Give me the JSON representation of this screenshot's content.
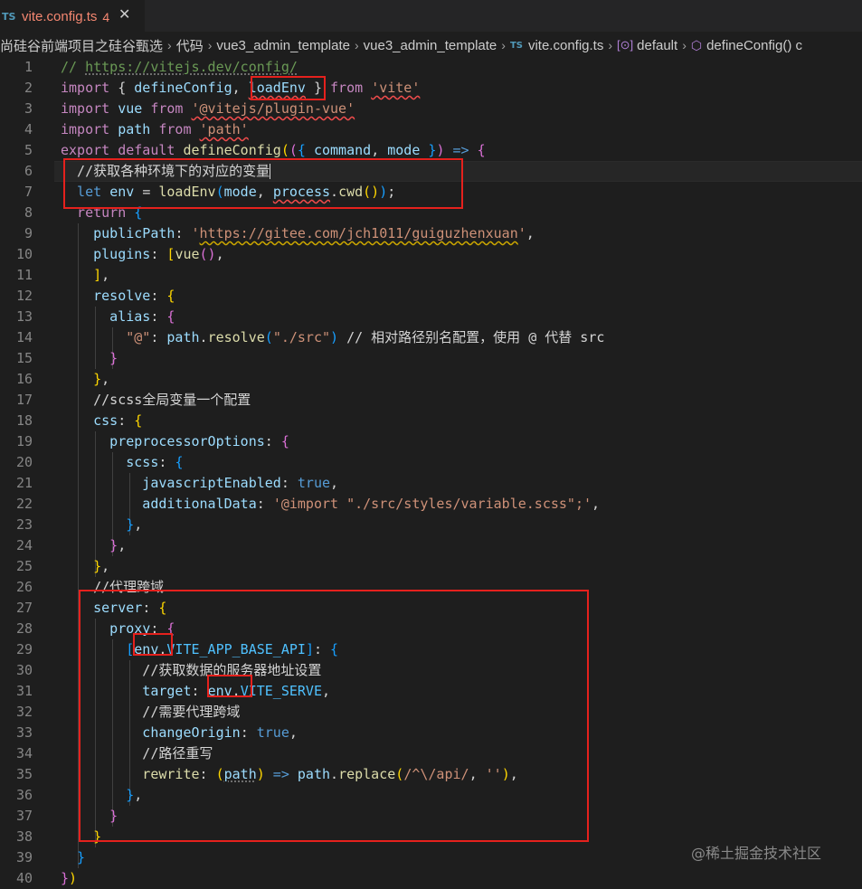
{
  "tab": {
    "icon": "TS",
    "filename": "vite.config.ts",
    "problems": "4",
    "close": "✕"
  },
  "breadcrumb": [
    "尚硅谷前端项目之硅谷甄选",
    "代码",
    "vue3_admin_template",
    "vue3_admin_template",
    "vite.config.ts",
    "default",
    "defineConfig() c"
  ],
  "watermark": "@稀土掘金技术社区",
  "colors": {
    "box": "#e5211d",
    "background": "#1e1e1e"
  },
  "line_numbers": [
    "1",
    "2",
    "3",
    "4",
    "5",
    "6",
    "7",
    "8",
    "9",
    "10",
    "11",
    "12",
    "13",
    "14",
    "15",
    "16",
    "17",
    "18",
    "19",
    "20",
    "21",
    "22",
    "23",
    "24",
    "25",
    "26",
    "27",
    "28",
    "29",
    "30",
    "31",
    "32",
    "33",
    "34",
    "35",
    "36",
    "37",
    "38",
    "39",
    "40"
  ],
  "code": [
    [
      [
        "cm",
        "// "
      ],
      [
        "cm sqd",
        "https://vitejs.dev/config/"
      ]
    ],
    [
      [
        "kw",
        "import "
      ],
      [
        "pn",
        "{ "
      ],
      [
        "vr",
        "defineConfig"
      ],
      [
        "pn",
        ", "
      ],
      [
        "vr sq",
        "loadEnv"
      ],
      [
        "pn",
        " } "
      ],
      [
        "kw",
        "from "
      ],
      [
        "st sq",
        "'vite'"
      ]
    ],
    [
      [
        "kw",
        "import "
      ],
      [
        "vr",
        "vue "
      ],
      [
        "kw",
        "from "
      ],
      [
        "st sq",
        "'@vitejs/plugin-vue'"
      ]
    ],
    [
      [
        "kw",
        "import "
      ],
      [
        "vr",
        "path "
      ],
      [
        "kw",
        "from "
      ],
      [
        "st sq",
        "'path'"
      ]
    ],
    [
      [
        "kw",
        "export default "
      ],
      [
        "fn",
        "defineConfig"
      ],
      [
        "b1",
        "("
      ],
      [
        "b2",
        "("
      ],
      [
        "b3",
        "{ "
      ],
      [
        "vr",
        "command"
      ],
      [
        "pn",
        ", "
      ],
      [
        "vr",
        "mode "
      ],
      [
        "b3",
        "}"
      ],
      [
        "b2",
        ")"
      ],
      [
        "bl",
        " => "
      ],
      [
        "b2",
        "{"
      ]
    ],
    [
      [
        "cmw",
        "  //获取各种环境下的对应的变量"
      ],
      [
        "caret",
        ""
      ]
    ],
    [
      [
        "bl",
        "  let "
      ],
      [
        "vr",
        "env "
      ],
      [
        "pn",
        "= "
      ],
      [
        "fn",
        "loadEnv"
      ],
      [
        "b3",
        "("
      ],
      [
        "vr",
        "mode"
      ],
      [
        "pn",
        ", "
      ],
      [
        "vr sq",
        "process"
      ],
      [
        "pn",
        "."
      ],
      [
        "fn",
        "cwd"
      ],
      [
        "b1",
        "()"
      ],
      [
        "b3",
        ")"
      ],
      [
        "pn",
        ";"
      ]
    ],
    [
      [
        "kw",
        "  return "
      ],
      [
        "b3",
        "{"
      ]
    ],
    [
      [
        "vr",
        "    publicPath"
      ],
      [
        "pn",
        ": "
      ],
      [
        "st",
        "'"
      ],
      [
        "st sqy",
        "https://gitee.com/jch1011/guiguzhenxuan"
      ],
      [
        "st",
        "'"
      ],
      [
        "pn",
        ","
      ]
    ],
    [
      [
        "vr",
        "    plugins"
      ],
      [
        "pn",
        ": "
      ],
      [
        "b1",
        "["
      ],
      [
        "fn",
        "vue"
      ],
      [
        "b2",
        "()"
      ],
      [
        "pn",
        ","
      ]
    ],
    [
      [
        "b1",
        "    ]"
      ],
      [
        "pn",
        ","
      ]
    ],
    [
      [
        "vr",
        "    resolve"
      ],
      [
        "pn",
        ": "
      ],
      [
        "b1",
        "{"
      ]
    ],
    [
      [
        "vr",
        "      alias"
      ],
      [
        "pn",
        ": "
      ],
      [
        "b2",
        "{"
      ]
    ],
    [
      [
        "st",
        "        \"@\""
      ],
      [
        "pn",
        ": "
      ],
      [
        "vr",
        "path"
      ],
      [
        "pn",
        "."
      ],
      [
        "fn",
        "resolve"
      ],
      [
        "b3",
        "("
      ],
      [
        "st",
        "\"./src\""
      ],
      [
        "b3",
        ")"
      ],
      [
        "cmw",
        " // 相对路径别名配置，使用 @ 代替 src"
      ]
    ],
    [
      [
        "b2",
        "      }"
      ]
    ],
    [
      [
        "b1",
        "    }"
      ],
      [
        "pn",
        ","
      ]
    ],
    [
      [
        "cmw",
        "    //scss全局变量一个配置"
      ]
    ],
    [
      [
        "vr",
        "    css"
      ],
      [
        "pn",
        ": "
      ],
      [
        "b1",
        "{"
      ]
    ],
    [
      [
        "vr",
        "      preprocessorOptions"
      ],
      [
        "pn",
        ": "
      ],
      [
        "b2",
        "{"
      ]
    ],
    [
      [
        "vr",
        "        scss"
      ],
      [
        "pn",
        ": "
      ],
      [
        "b3",
        "{"
      ]
    ],
    [
      [
        "vr",
        "          javascriptEnabled"
      ],
      [
        "pn",
        ": "
      ],
      [
        "bl",
        "true"
      ],
      [
        "pn",
        ","
      ]
    ],
    [
      [
        "vr",
        "          additionalData"
      ],
      [
        "pn",
        ": "
      ],
      [
        "st",
        "'@import \"./src/styles/variable.scss\";'"
      ],
      [
        "pn",
        ","
      ]
    ],
    [
      [
        "b3",
        "        }"
      ],
      [
        "pn",
        ","
      ]
    ],
    [
      [
        "b2",
        "      }"
      ],
      [
        "pn",
        ","
      ]
    ],
    [
      [
        "b1",
        "    }"
      ],
      [
        "pn",
        ","
      ]
    ],
    [
      [
        "cmw",
        "    //代理跨域"
      ]
    ],
    [
      [
        "vr",
        "    server"
      ],
      [
        "pn",
        ": "
      ],
      [
        "b1",
        "{"
      ]
    ],
    [
      [
        "vr",
        "      proxy"
      ],
      [
        "pn",
        ": "
      ],
      [
        "b2",
        "{"
      ]
    ],
    [
      [
        "b3",
        "        ["
      ],
      [
        "vr",
        "env"
      ],
      [
        "pn",
        "."
      ],
      [
        "cn",
        "VITE_APP_BASE_API"
      ],
      [
        "b3",
        "]"
      ],
      [
        "pn",
        ": "
      ],
      [
        "b3",
        "{"
      ]
    ],
    [
      [
        "cmw",
        "          //获取数据的服务器地址设置"
      ]
    ],
    [
      [
        "vr",
        "          target"
      ],
      [
        "pn",
        ": "
      ],
      [
        "vr",
        "env"
      ],
      [
        "pn",
        "."
      ],
      [
        "cn",
        "VITE_SERVE"
      ],
      [
        "pn",
        ","
      ]
    ],
    [
      [
        "cmw",
        "          //需要代理跨域"
      ]
    ],
    [
      [
        "vr",
        "          changeOrigin"
      ],
      [
        "pn",
        ": "
      ],
      [
        "bl",
        "true"
      ],
      [
        "pn",
        ","
      ]
    ],
    [
      [
        "cmw",
        "          //路径重写"
      ]
    ],
    [
      [
        "fn",
        "          rewrite"
      ],
      [
        "pn",
        ": "
      ],
      [
        "b1",
        "("
      ],
      [
        "vr sqd",
        "path"
      ],
      [
        "b1",
        ")"
      ],
      [
        "bl",
        " => "
      ],
      [
        "vr",
        "path"
      ],
      [
        "pn",
        "."
      ],
      [
        "fn",
        "replace"
      ],
      [
        "b1",
        "("
      ],
      [
        "st",
        "/^\\/api/"
      ],
      [
        "pn",
        ", "
      ],
      [
        "st",
        "''"
      ],
      [
        "b1",
        ")"
      ],
      [
        "pn",
        ","
      ]
    ],
    [
      [
        "b3",
        "        }"
      ],
      [
        "pn",
        ","
      ]
    ],
    [
      [
        "b2",
        "      }"
      ]
    ],
    [
      [
        "b1",
        "    }"
      ]
    ],
    [
      [
        "b3",
        "  }"
      ]
    ],
    [
      [
        "b2",
        "}"
      ],
      [
        "b1",
        ")"
      ]
    ]
  ]
}
